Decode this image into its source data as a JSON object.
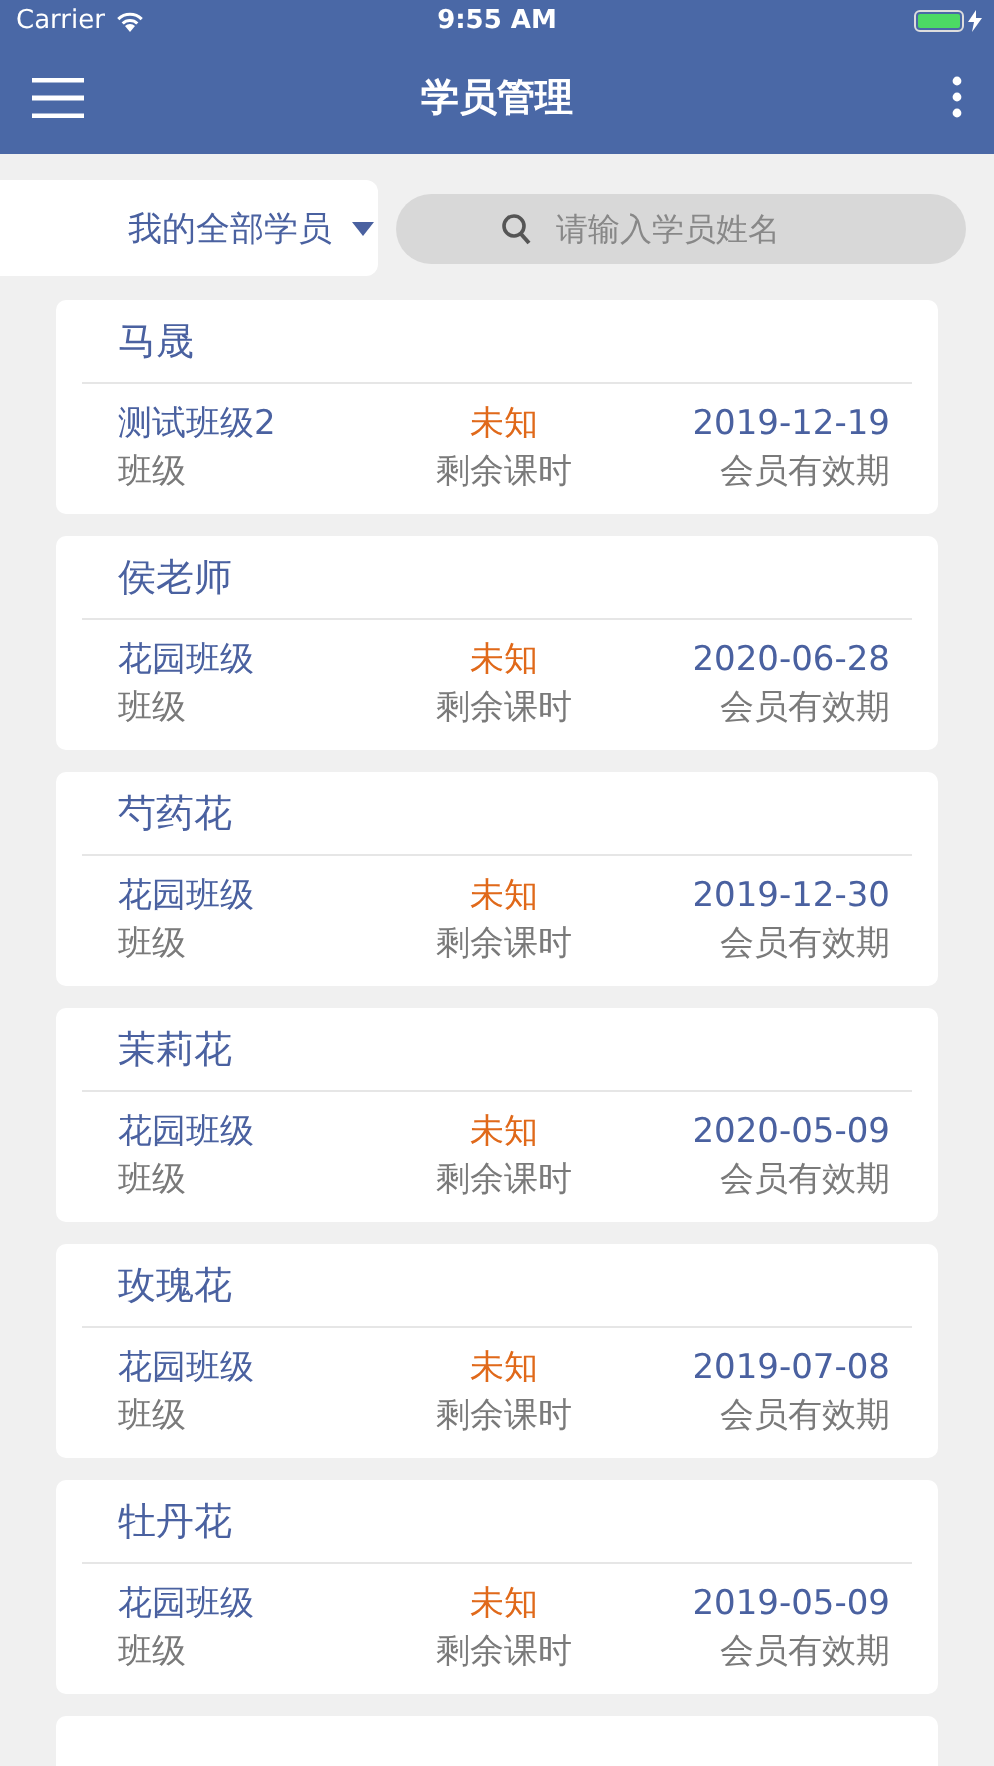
{
  "status_bar": {
    "carrier": "Carrier",
    "time": "9:55 AM"
  },
  "header": {
    "title": "学员管理"
  },
  "filter": {
    "dropdown": "我的全部学员",
    "search": {
      "placeholder": "请输入学员姓名"
    }
  },
  "students": [
    {
      "name": "马晟",
      "class": "测试班级2",
      "class_label": "班级",
      "remaining": "未知",
      "remaining_label": "剩余课时",
      "expiry": "2019-12-19",
      "expiry_label": "会员有效期"
    },
    {
      "name": "侯老师",
      "class": "花园班级",
      "class_label": "班级",
      "remaining": "未知",
      "remaining_label": "剩余课时",
      "expiry": "2020-06-28",
      "expiry_label": "会员有效期"
    },
    {
      "name": "芍药花",
      "class": "花园班级",
      "class_label": "班级",
      "remaining": "未知",
      "remaining_label": "剩余课时",
      "expiry": "2019-12-30",
      "expiry_label": "会员有效期"
    },
    {
      "name": "茉莉花",
      "class": "花园班级",
      "class_label": "班级",
      "remaining": "未知",
      "remaining_label": "剩余课时",
      "expiry": "2020-05-09",
      "expiry_label": "会员有效期"
    },
    {
      "name": "玫瑰花",
      "class": "花园班级",
      "class_label": "班级",
      "remaining": "未知",
      "remaining_label": "剩余课时",
      "expiry": "2019-07-08",
      "expiry_label": "会员有效期"
    },
    {
      "name": "牡丹花",
      "class": "花园班级",
      "class_label": "班级",
      "remaining": "未知",
      "remaining_label": "剩余课时",
      "expiry": "2019-05-09",
      "expiry_label": "会员有效期"
    }
  ],
  "more_below": true
}
